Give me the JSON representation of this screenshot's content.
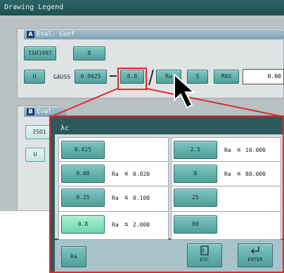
{
  "window": {
    "title": "Drawing Legend"
  },
  "panel_a": {
    "tag": "A",
    "title": "Eval. Conf",
    "standard_label": "ISO1997",
    "unit_label": "B",
    "filter_button": "U",
    "filter_name": "GAUSS",
    "cutoff_short": "0.0025",
    "cutoff_long": "0.8",
    "param_button": "Ra",
    "count_button": "5",
    "mode_button": "MAX",
    "result_value": "0.00"
  },
  "panel_b": {
    "tag": "B",
    "title": "Eval.",
    "standard_label": "ISO1",
    "unit_label": "U"
  },
  "popup": {
    "title": "λc",
    "left_rows": [
      {
        "value": "0.025",
        "param": "",
        "op": "",
        "limit": ""
      },
      {
        "value": "0.08",
        "param": "Ra",
        "op": "≤",
        "limit": "0.020"
      },
      {
        "value": "0.25",
        "param": "Ra",
        "op": "≤",
        "limit": "0.100"
      },
      {
        "value": "0.8",
        "param": "Ra",
        "op": "≤",
        "limit": "2.000"
      }
    ],
    "right_rows": [
      {
        "value": "2.5",
        "param": "Ra",
        "op": "≤",
        "limit": "10.000"
      },
      {
        "value": "8",
        "param": "Ra",
        "op": "≤",
        "limit": "80.000"
      },
      {
        "value": "25",
        "param": "",
        "op": "",
        "limit": ""
      },
      {
        "value": "80",
        "param": "",
        "op": "",
        "limit": ""
      }
    ],
    "param_button": "Ra",
    "esc_label": "ESC",
    "enter_label": "ENTER"
  }
}
